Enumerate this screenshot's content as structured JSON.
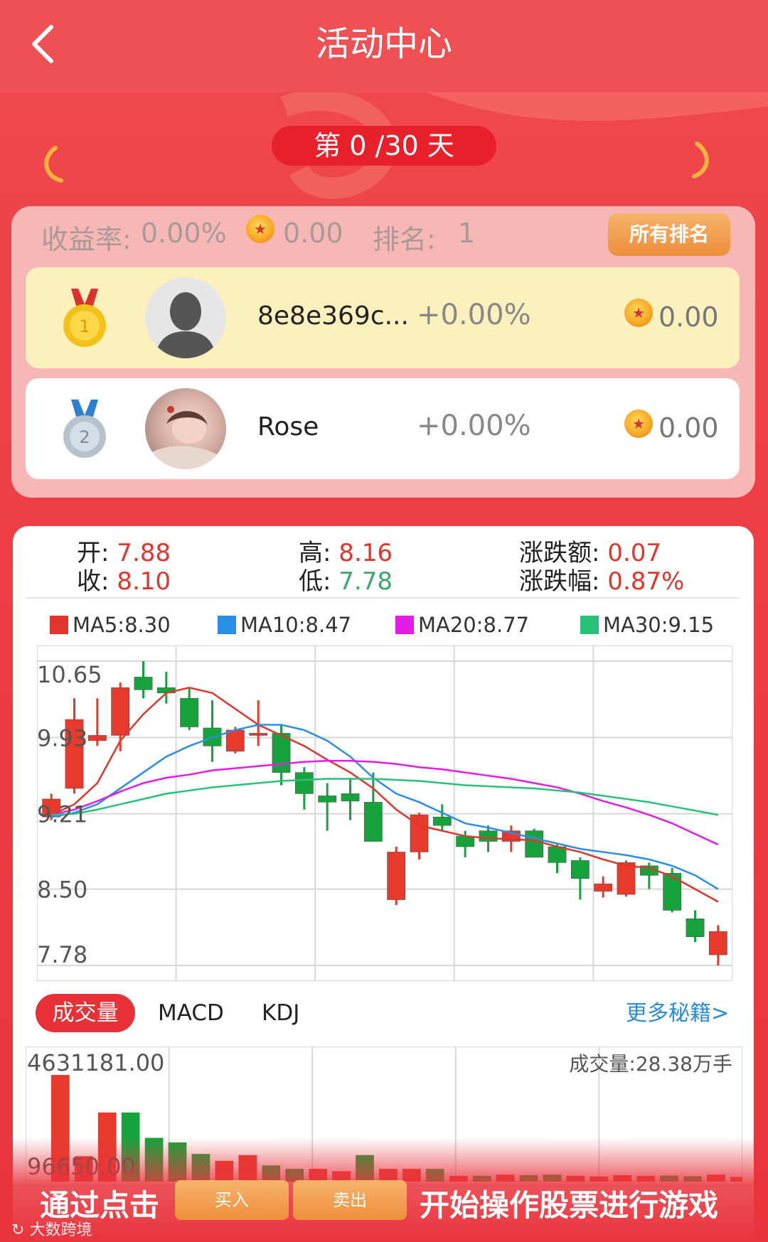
{
  "header": {
    "back_icon": "chevron-left-icon",
    "title": "活动中心"
  },
  "progress": {
    "day_label": "第 0 /30 天",
    "current_day": 0,
    "total_days": 30
  },
  "summary": {
    "return_label": "收益率:",
    "return_value": "0.00%",
    "coin_value": "0.00",
    "rank_label": "排名:",
    "rank_value": "1",
    "all_rank_button": "所有排名"
  },
  "ranking": [
    {
      "medal": "1",
      "name": "8e8e369c...",
      "pct": "+0.00%",
      "coins": "0.00",
      "avatar": "default-avatar"
    },
    {
      "medal": "2",
      "name": "Rose",
      "pct": "+0.00%",
      "coins": "0.00",
      "avatar": "photo-avatar"
    }
  ],
  "quote": {
    "open_label": "开:",
    "open": "7.88",
    "high_label": "高:",
    "high": "8.16",
    "change_label": "涨跌额:",
    "change": "0.07",
    "close_label": "收:",
    "close": "8.10",
    "low_label": "低:",
    "low": "7.78",
    "change_pct_label": "涨跌幅:",
    "change_pct": "0.87%"
  },
  "ma_legend": [
    {
      "label": "MA5:8.30",
      "color": "#e2362c"
    },
    {
      "label": "MA10:8.47",
      "color": "#2a8ee6"
    },
    {
      "label": "MA20:8.77",
      "color": "#e21ee6"
    },
    {
      "label": "MA30:9.15",
      "color": "#27c27a"
    }
  ],
  "tabs": {
    "volume": "成交量",
    "macd": "MACD",
    "kdj": "KDJ",
    "more": "更多秘籍>"
  },
  "volume": {
    "max_label": "4631181.00",
    "min_label": "96650.00",
    "total_label": "成交量:28.38万手"
  },
  "bottom": {
    "text_left": "通过点击",
    "buy": "买入",
    "sell": "卖出",
    "text_right": "开始操作股票进行游戏",
    "watermark": "大数跨境"
  },
  "chart_data": {
    "type": "candlestick",
    "ylim": [
      7.78,
      10.65
    ],
    "y_ticks": [
      "10.65",
      "9.93",
      "9.21",
      "8.50",
      "7.78"
    ],
    "candles": [
      {
        "o": 9.18,
        "c": 9.35,
        "h": 9.4,
        "l": 9.15
      },
      {
        "o": 9.45,
        "c": 10.1,
        "h": 10.3,
        "l": 9.4
      },
      {
        "o": 9.9,
        "c": 9.95,
        "h": 10.3,
        "l": 9.85
      },
      {
        "o": 9.95,
        "c": 10.4,
        "h": 10.45,
        "l": 9.8
      },
      {
        "o": 10.5,
        "c": 10.38,
        "h": 10.65,
        "l": 10.3
      },
      {
        "o": 10.4,
        "c": 10.35,
        "h": 10.55,
        "l": 10.25
      },
      {
        "o": 10.3,
        "c": 10.03,
        "h": 10.4,
        "l": 10.0
      },
      {
        "o": 10.02,
        "c": 9.85,
        "h": 10.28,
        "l": 9.7
      },
      {
        "o": 9.8,
        "c": 10.0,
        "h": 10.03,
        "l": 9.78
      },
      {
        "o": 9.95,
        "c": 9.97,
        "h": 10.28,
        "l": 9.85
      },
      {
        "o": 9.97,
        "c": 9.6,
        "h": 10.05,
        "l": 9.48
      },
      {
        "o": 9.6,
        "c": 9.4,
        "h": 9.65,
        "l": 9.25
      },
      {
        "o": 9.38,
        "c": 9.32,
        "h": 9.5,
        "l": 9.05
      },
      {
        "o": 9.4,
        "c": 9.33,
        "h": 9.55,
        "l": 9.15
      },
      {
        "o": 9.32,
        "c": 8.95,
        "h": 9.6,
        "l": 8.95
      },
      {
        "o": 8.4,
        "c": 8.85,
        "h": 8.9,
        "l": 8.35
      },
      {
        "o": 8.85,
        "c": 9.2,
        "h": 9.22,
        "l": 8.78
      },
      {
        "o": 9.18,
        "c": 9.1,
        "h": 9.3,
        "l": 9.05
      },
      {
        "o": 9.0,
        "c": 8.9,
        "h": 9.05,
        "l": 8.8
      },
      {
        "o": 9.05,
        "c": 8.95,
        "h": 9.1,
        "l": 8.85
      },
      {
        "o": 8.95,
        "c": 9.05,
        "h": 9.1,
        "l": 8.85
      },
      {
        "o": 9.05,
        "c": 8.8,
        "h": 9.07,
        "l": 8.8
      },
      {
        "o": 8.9,
        "c": 8.75,
        "h": 8.92,
        "l": 8.65
      },
      {
        "o": 8.77,
        "c": 8.6,
        "h": 8.8,
        "l": 8.4
      },
      {
        "o": 8.48,
        "c": 8.55,
        "h": 8.62,
        "l": 8.42
      },
      {
        "o": 8.45,
        "c": 8.75,
        "h": 8.77,
        "l": 8.43
      },
      {
        "o": 8.72,
        "c": 8.63,
        "h": 8.75,
        "l": 8.5
      },
      {
        "o": 8.65,
        "c": 8.3,
        "h": 8.7,
        "l": 8.28
      },
      {
        "o": 8.22,
        "c": 8.05,
        "h": 8.3,
        "l": 8.0
      },
      {
        "o": 7.88,
        "c": 8.1,
        "h": 8.16,
        "l": 7.78
      }
    ],
    "ma5": [
      9.2,
      9.3,
      9.5,
      9.9,
      10.15,
      10.35,
      10.4,
      10.35,
      10.2,
      10.05,
      9.95,
      9.85,
      9.72,
      9.6,
      9.45,
      9.25,
      9.1,
      9.05,
      9.0,
      8.98,
      8.97,
      8.96,
      8.9,
      8.85,
      8.78,
      8.72,
      8.7,
      8.62,
      8.5,
      8.38
    ],
    "ma10": [
      9.18,
      9.22,
      9.3,
      9.45,
      9.6,
      9.75,
      9.85,
      9.93,
      10.0,
      10.05,
      10.05,
      10.0,
      9.9,
      9.75,
      9.55,
      9.4,
      9.32,
      9.22,
      9.12,
      9.08,
      9.03,
      8.98,
      8.93,
      8.88,
      8.85,
      8.82,
      8.78,
      8.72,
      8.63,
      8.5
    ],
    "ma20": [
      9.2,
      9.25,
      9.33,
      9.42,
      9.5,
      9.55,
      9.58,
      9.62,
      9.64,
      9.66,
      9.68,
      9.7,
      9.71,
      9.71,
      9.7,
      9.68,
      9.65,
      9.63,
      9.6,
      9.57,
      9.54,
      9.5,
      9.46,
      9.4,
      9.33,
      9.27,
      9.2,
      9.12,
      9.02,
      8.92
    ],
    "ma30": [
      9.2,
      9.21,
      9.25,
      9.3,
      9.35,
      9.4,
      9.43,
      9.46,
      9.48,
      9.5,
      9.52,
      9.53,
      9.54,
      9.54,
      9.54,
      9.53,
      9.52,
      9.5,
      9.48,
      9.47,
      9.46,
      9.45,
      9.43,
      9.41,
      9.38,
      9.35,
      9.32,
      9.28,
      9.24,
      9.2
    ],
    "volume": {
      "ylim": [
        96650,
        4631181
      ],
      "bars": [
        {
          "v": 4630000,
          "up": true
        },
        {
          "v": 1100000,
          "up": true
        },
        {
          "v": 3000000,
          "up": true
        },
        {
          "v": 3000000,
          "up": false
        },
        {
          "v": 1900000,
          "up": false
        },
        {
          "v": 1700000,
          "up": false
        },
        {
          "v": 1200000,
          "up": false
        },
        {
          "v": 900000,
          "up": true
        },
        {
          "v": 1150000,
          "up": true
        },
        {
          "v": 700000,
          "up": false
        },
        {
          "v": 550000,
          "up": false
        },
        {
          "v": 550000,
          "up": true
        },
        {
          "v": 450000,
          "up": true
        },
        {
          "v": 1150000,
          "up": false
        },
        {
          "v": 550000,
          "up": true
        },
        {
          "v": 550000,
          "up": true
        },
        {
          "v": 550000,
          "up": false
        },
        {
          "v": 250000,
          "up": true
        },
        {
          "v": 250000,
          "up": false
        },
        {
          "v": 300000,
          "up": true
        },
        {
          "v": 280000,
          "up": false
        },
        {
          "v": 300000,
          "up": false
        },
        {
          "v": 250000,
          "up": true
        },
        {
          "v": 220000,
          "up": true
        },
        {
          "v": 280000,
          "up": true
        },
        {
          "v": 250000,
          "up": true
        },
        {
          "v": 260000,
          "up": false
        },
        {
          "v": 230000,
          "up": false
        },
        {
          "v": 300000,
          "up": true
        },
        {
          "v": 200000,
          "up": true
        }
      ]
    }
  }
}
